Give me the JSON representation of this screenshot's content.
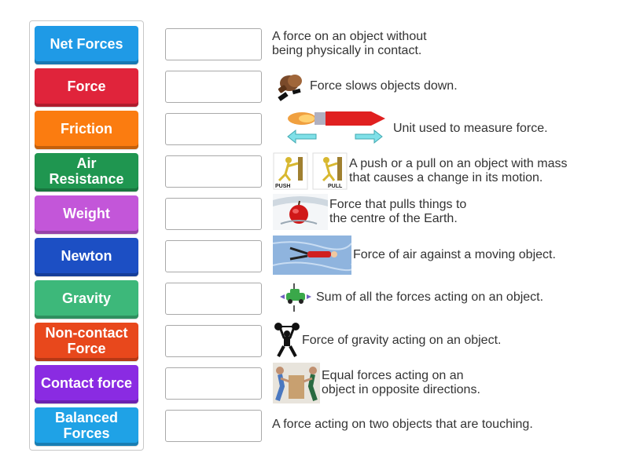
{
  "tiles": [
    {
      "label": "Net Forces",
      "color": "#1f9ae6"
    },
    {
      "label": "Force",
      "color": "#e0243b"
    },
    {
      "label": "Friction",
      "color": "#fb7c10"
    },
    {
      "label": "Air Resistance",
      "color": "#1f9650"
    },
    {
      "label": "Weight",
      "color": "#c356d9"
    },
    {
      "label": "Newton",
      "color": "#1c4fc4"
    },
    {
      "label": "Gravity",
      "color": "#3db87a"
    },
    {
      "label": "Non-contact Force",
      "color": "#e8481c"
    },
    {
      "label": "Contact force",
      "color": "#8a2be2"
    },
    {
      "label": "Balanced Forces",
      "color": "#1fa2e6"
    }
  ],
  "definitions": [
    {
      "text": "A force on an object without\nbeing physically in contact.",
      "icon": "none"
    },
    {
      "text": "Force slows objects down.",
      "icon": "rubbing-hands-icon"
    },
    {
      "text": "Unit used to measure force.",
      "icon": "rocket-force-arrows-icon"
    },
    {
      "text": "A push or a pull on an object with mass\nthat causes a change in its motion.",
      "icon": "push-pull-icon"
    },
    {
      "text": "Force that pulls things to\nthe centre of the Earth.",
      "icon": "apple-splash-icon"
    },
    {
      "text": "Force of air against a moving object.",
      "icon": "skydiver-icon"
    },
    {
      "text": "Sum of all the forces acting on an object.",
      "icon": "car-force-diagram-icon"
    },
    {
      "text": "Force of gravity acting on an object.",
      "icon": "weightlifter-icon"
    },
    {
      "text": "Equal forces acting on an\nobject in opposite directions.",
      "icon": "pushing-box-icon"
    },
    {
      "text": "A force acting on two objects that are touching.",
      "icon": "none"
    }
  ],
  "icon_labels": {
    "push": "PUSH",
    "pull": "PULL"
  }
}
